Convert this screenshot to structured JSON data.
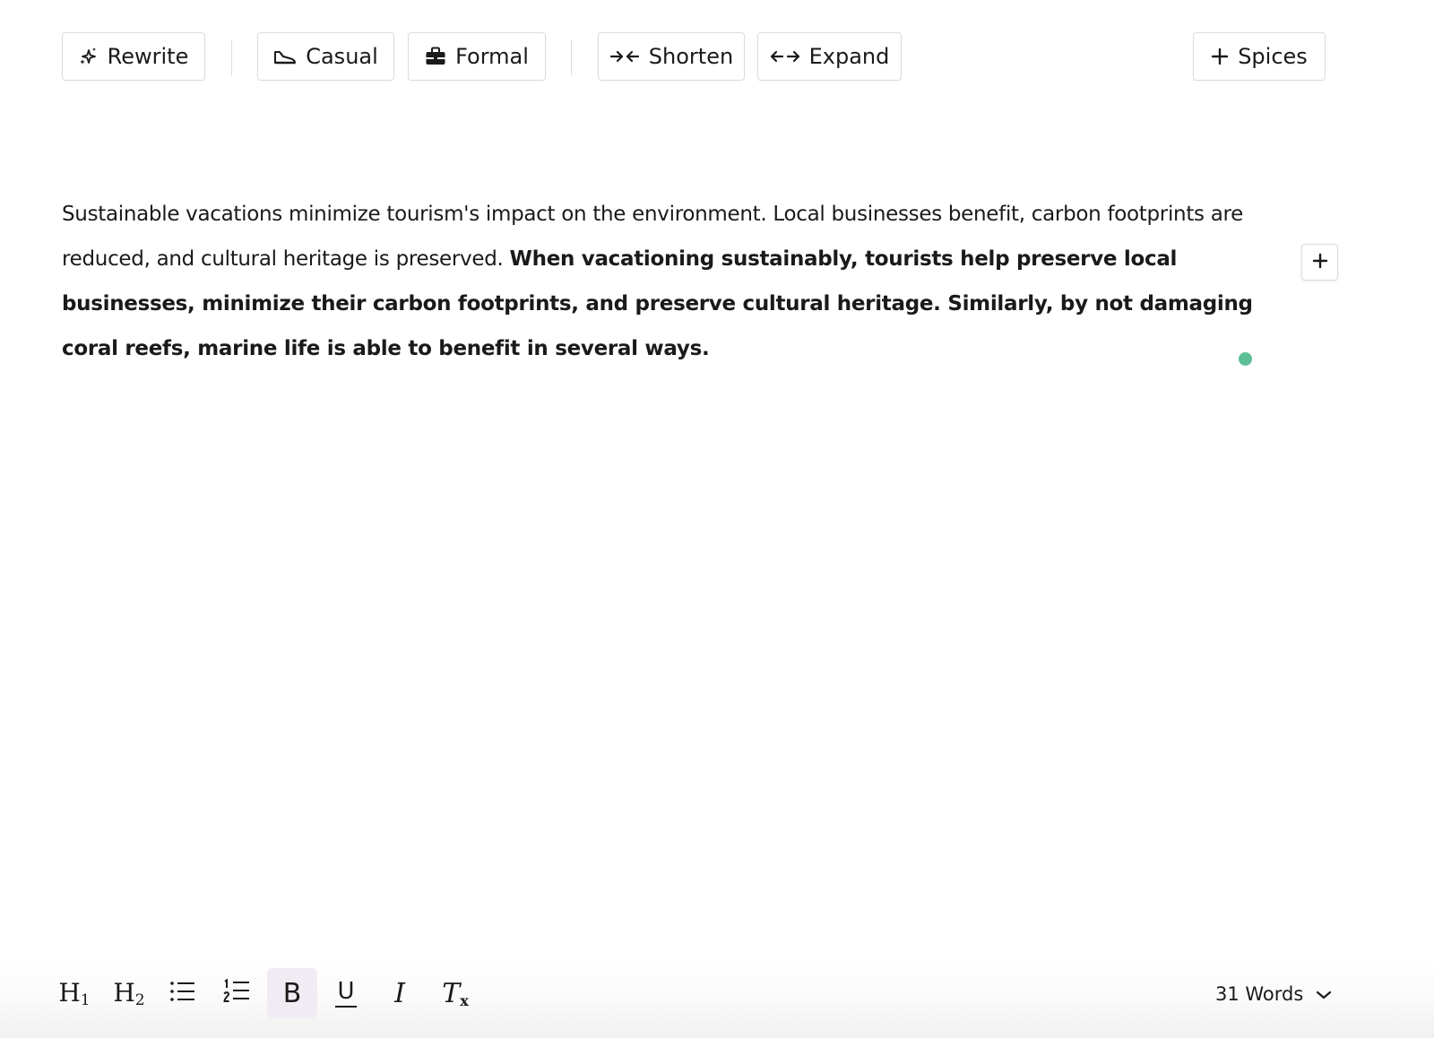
{
  "toolbar": {
    "rewrite_label": "Rewrite",
    "casual_label": "Casual",
    "formal_label": "Formal",
    "shorten_label": "Shorten",
    "expand_label": "Expand",
    "spices_label": "Spices"
  },
  "editor": {
    "paragraph_normal": "Sustainable vacations minimize tourism's impact on the environment. Local businesses benefit, carbon footprints are reduced, and cultural heritage is preserved. ",
    "paragraph_bold": "When vacationing sustainably, tourists help preserve local businesses, minimize their carbon footprints, and preserve cultural heritage. Similarly, by not damaging coral reefs, marine life is able to benefit in several ways."
  },
  "format_bar": {
    "h1_label": "H",
    "h1_sub": "1",
    "h2_label": "H",
    "h2_sub": "2",
    "bold_label": "B",
    "underline_label": "U",
    "italic_label": "I",
    "clear_label": "T",
    "clear_sub": "x",
    "word_count": "31 Words"
  },
  "icons": {
    "rewrite": "sparkle-icon",
    "casual": "sneaker-icon",
    "formal": "briefcase-icon",
    "shorten": "arrows-inward-icon",
    "expand": "arrows-outward-icon",
    "spices": "plus-icon",
    "side_add": "plus-icon",
    "bullet_list": "bullet-list-icon",
    "numbered_list": "numbered-list-icon",
    "word_count_toggle": "chevron-down-icon"
  },
  "colors": {
    "status_dot": "#5cbf96",
    "active_button_bg": "#f1ecf4"
  }
}
